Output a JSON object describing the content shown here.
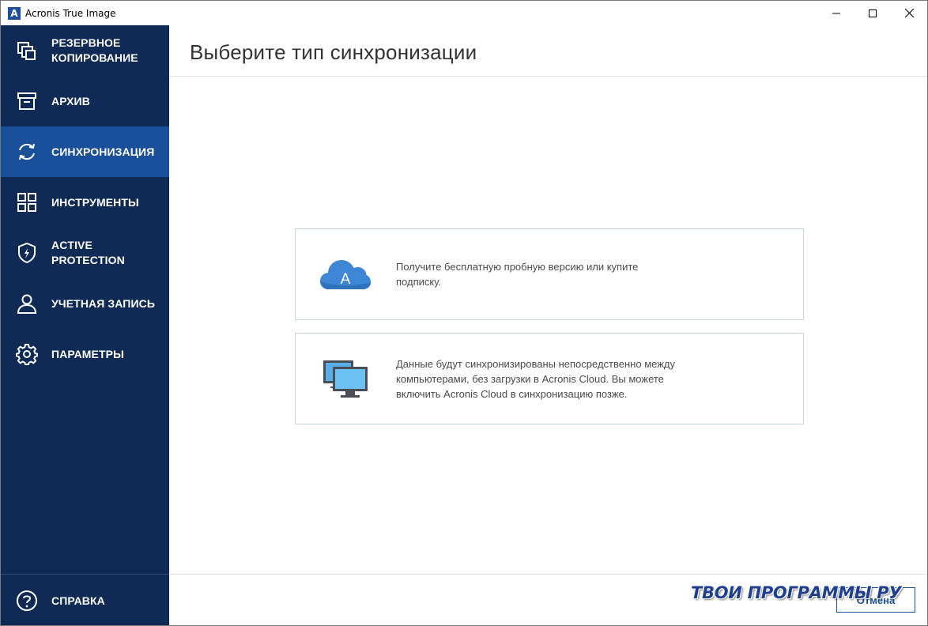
{
  "window": {
    "title": "Acronis True Image",
    "app_icon_letter": "A",
    "controls": [
      "minimize-icon",
      "maximize-icon",
      "close-icon"
    ]
  },
  "sidebar": {
    "items": [
      {
        "label": "РЕЗЕРВНОЕ КОПИРОВАНИЕ",
        "icon": "backup-icon",
        "active": false
      },
      {
        "label": "АРХИВ",
        "icon": "archive-icon",
        "active": false
      },
      {
        "label": "СИНХРОНИЗАЦИЯ",
        "icon": "sync-icon",
        "active": true
      },
      {
        "label": "ИНСТРУМЕНТЫ",
        "icon": "tools-grid-icon",
        "active": false
      },
      {
        "label": "ACTIVE PROTECTION",
        "icon": "shield-icon",
        "active": false
      },
      {
        "label": "УЧЕТНАЯ ЗАПИСЬ",
        "icon": "user-icon",
        "active": false
      },
      {
        "label": "ПАРАМЕТРЫ",
        "icon": "gear-icon",
        "active": false
      }
    ],
    "help": {
      "label": "СПРАВКА",
      "icon": "help-icon"
    }
  },
  "main": {
    "title": "Выберите тип синхронизации",
    "options": [
      {
        "icon": "cloud-icon",
        "icon_letter": "A",
        "text": "Получите бесплатную пробную версию или купите подписку."
      },
      {
        "icon": "computers-icon",
        "text": "Данные будут синхронизированы непосредственно между компьютерами, без загрузки в Acronis Cloud. Вы можете включить Acronis Cloud в синхронизацию позже."
      }
    ],
    "cancel_label": "Отмена"
  },
  "watermark": "ТВОИ ПРОГРАММЫ РУ",
  "colors": {
    "sidebar_bg": "#0e2a55",
    "sidebar_active": "#1a4f9a",
    "accent": "#1a4f9a",
    "cloud": "#4a90d9"
  }
}
